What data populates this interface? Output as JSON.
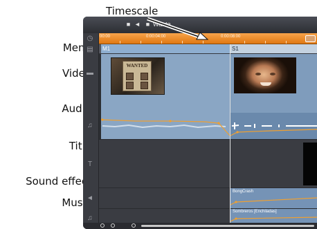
{
  "callouts": {
    "timescale": "Timescale"
  },
  "track_labels": {
    "menu": "Menu",
    "video": "Video",
    "audio": "Audio",
    "title": "Title",
    "sound_effect": "Sound effect",
    "music": "Music"
  },
  "toolbar": {
    "project_title": "Wante",
    "icons": [
      "video-camera-icon",
      "speaker-icon",
      "folder-icon"
    ]
  },
  "ruler": {
    "times": [
      "00:00",
      "0:00:04:00",
      "0:00:08:00"
    ]
  },
  "markers": {
    "menu_1": "M1",
    "scene_1": "S1"
  },
  "clips": {
    "poster_text": "WANTED",
    "sound_effect": "BongCrash",
    "music": "Sombreros [Enchiladas]"
  },
  "gutter_icons": [
    "clock-icon",
    "menu-track-icon",
    "video-track-icon",
    "audio-track-icon",
    "title-track-icon",
    "sound-effect-track-icon",
    "music-track-icon"
  ],
  "colors": {
    "ruler_orange": "#e88a24",
    "clip_blue": "#8aa6c4",
    "volume_line": "#f0a030"
  }
}
